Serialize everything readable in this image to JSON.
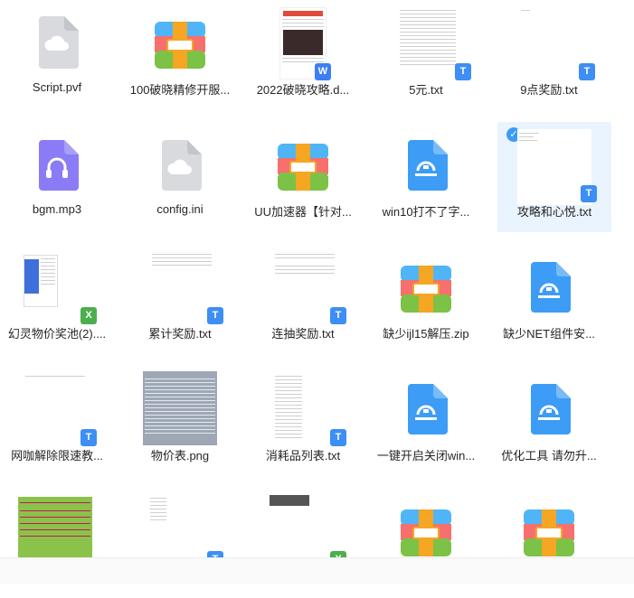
{
  "files": [
    {
      "name": "Script.pvf"
    },
    {
      "name": "100破晓精修开服..."
    },
    {
      "name": "2022破晓攻略.d..."
    },
    {
      "name": "5元.txt"
    },
    {
      "name": "9点奖励.txt"
    },
    {
      "name": "bgm.mp3"
    },
    {
      "name": "config.ini"
    },
    {
      "name": "UU加速器【针对..."
    },
    {
      "name": "win10打不了字..."
    },
    {
      "name": "攻略和心悦.txt"
    },
    {
      "name": "幻灵物价奖池(2)...."
    },
    {
      "name": "累计奖励.txt"
    },
    {
      "name": "连抽奖励.txt"
    },
    {
      "name": "缺少ijl15解压.zip"
    },
    {
      "name": "缺少NET组件安..."
    },
    {
      "name": "网咖解除限速教..."
    },
    {
      "name": "物价表.png"
    },
    {
      "name": "消耗品列表.txt"
    },
    {
      "name": "一键开启关闭win..."
    },
    {
      "name": "优化工具 请勿升..."
    }
  ],
  "badges": {
    "txt": "T",
    "excel": "X",
    "word": "W",
    "check": "✓"
  },
  "colors": {
    "accent": "#3d8ef5",
    "selection": "#eaf4fe",
    "archive_blue": "#4fb5f7",
    "archive_red": "#f7706d",
    "archive_green": "#7bc246",
    "archive_band": "#f5a623"
  }
}
